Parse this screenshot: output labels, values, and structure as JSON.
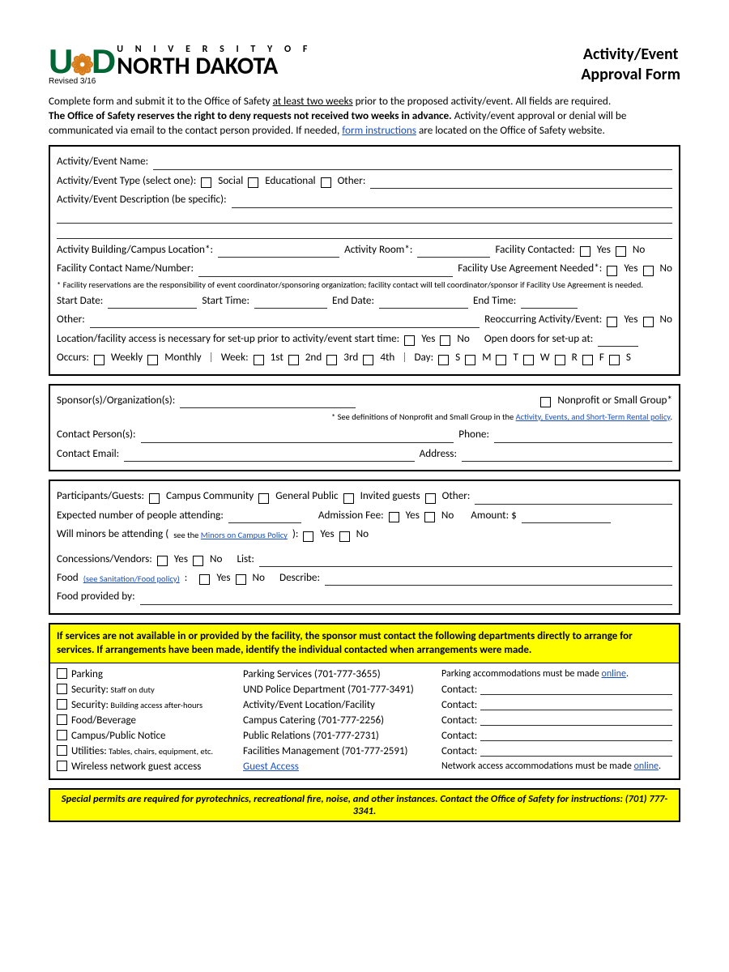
{
  "header": {
    "logo_mark": "UND",
    "logo_small": "U N I V E R S I T Y   O F",
    "logo_big": "NORTH DAKOTA",
    "revised": "Revised 3/16",
    "title_l1": "Activity/Event",
    "title_l2": "Approval Form"
  },
  "intro": {
    "p1a": "Complete form and submit it to the Office of Safety ",
    "p1u": "at least two weeks",
    "p1b": " prior to the proposed activity/event. All fields are required.",
    "p2": "The Office of Safety reserves the right to deny requests not received two weeks in advance.",
    "p3a": " Activity/event approval or denial will be communicated via email to the contact person provided. If needed, ",
    "p3link": "form instructions",
    "p3b": " are located on the Office of Safety website."
  },
  "s1": {
    "name": "Activity/Event Name:",
    "type": "Activity/Event Type (select one):",
    "type_opts": [
      "Social",
      "Educational",
      "Other:"
    ],
    "desc": "Activity/Event Description (be specific):",
    "building": "Activity Building/Campus Location*:",
    "room": "Activity Room*:",
    "facility_contacted": "Facility Contacted:",
    "contact_name": "Facility Contact Name/Number:",
    "agreement": "Facility Use Agreement Needed*:",
    "footnote": "* Facility reservations are the responsibility of event coordinator/sponsoring organization; facility contact will tell coordinator/sponsor if Facility Use Agreement is needed.",
    "start_date": "Start Date:",
    "start_time": "Start Time:",
    "end_date": "End Date:",
    "end_time": "End Time:",
    "other": "Other:",
    "reoccurring": "Reoccurring Activity/Event:",
    "access_line": "Location/facility access is necessary for set-up prior to activity/event start time:",
    "open_doors": "Open doors for set-up at:",
    "occurs": "Occurs:",
    "weekly": "Weekly",
    "monthly": "Monthly",
    "week_lbl": "Week:",
    "weeks": [
      "1st",
      "2nd",
      "3rd",
      "4th"
    ],
    "day_lbl": "Day:",
    "days": [
      "S",
      "M",
      "T",
      "W",
      "R",
      "F",
      "S"
    ],
    "yes": "Yes",
    "no": "No"
  },
  "s2": {
    "sponsor": "Sponsor(s)/Organization(s):",
    "nonprofit": "Nonprofit or Small Group*",
    "defs_a": "* See definitions of Nonprofit and Small Group in the ",
    "defs_link": "Activity, Events, and Short-Term Rental policy",
    "contact_person": "Contact Person(s):",
    "phone": "Phone:",
    "email": "Contact Email:",
    "address": "Address:"
  },
  "s3": {
    "participants": "Participants/Guests:",
    "p_opts": [
      "Campus Community",
      "General Public",
      "Invited guests",
      "Other:"
    ],
    "expected": "Expected number of people attending:",
    "admission": "Admission Fee:",
    "amount": "Amount: $",
    "minors_a": "Will minors be attending (",
    "minors_see": "see the ",
    "minors_link": "Minors on Campus Policy",
    "minors_b": "):",
    "vendors": "Concessions/Vendors:",
    "list": "List:",
    "food": "Food ",
    "food_link": "(see Sanitation/Food policy)",
    "food_colon": ":",
    "describe": "Describe:",
    "provided": "Food provided by:",
    "yes": "Yes",
    "no": "No"
  },
  "s4": {
    "banner": "If services are not available in or provided by the facility, the sponsor must contact the following departments directly to arrange for services. If arrangements have been made, identify the individual contacted when arrangements were made.",
    "rows": [
      {
        "label": "Parking",
        "sub": "",
        "dept": "Parking Services (701-777-3655)",
        "right": "Parking accommodations must be made ",
        "right_link": "online",
        "right_suffix": "."
      },
      {
        "label": "Security:",
        "sub": " Staff on duty",
        "dept": "UND Police Department (701-777-3491)",
        "right": "Contact:",
        "blank": true
      },
      {
        "label": "Security:",
        "sub": " Building access after-hours",
        "dept": "Activity/Event Location/Facility",
        "right": "Contact:",
        "blank": true
      },
      {
        "label": "Food/Beverage",
        "sub": "",
        "dept": "Campus Catering (701-777-2256)",
        "right": "Contact:",
        "blank": true
      },
      {
        "label": "Campus/Public Notice",
        "sub": "",
        "dept": "Public Relations (701-777-2731)",
        "right": "Contact:",
        "blank": true
      },
      {
        "label": "Utilities:",
        "sub": " Tables, chairs, equipment, etc.",
        "dept": "Facilities Management (701-777-2591)",
        "right": "Contact:",
        "blank": true
      },
      {
        "label": "Wireless network guest access",
        "sub": "",
        "dept_link": "Guest Access",
        "right": "Network access accommodations must be made ",
        "right_link": "online",
        "right_suffix": "."
      }
    ]
  },
  "permit": "Special permits are required for pyrotechnics, recreational fire, noise, and other instances. Contact the Office of Safety for instructions: (701) 777-3341."
}
